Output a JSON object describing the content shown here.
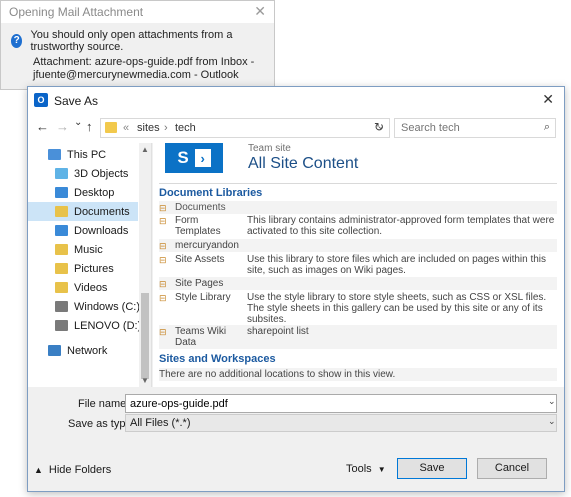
{
  "bg_dialog": {
    "title": "Opening Mail Attachment",
    "warning": "You should only open attachments from a trustworthy source.",
    "attachment_line1": "Attachment: azure-ops-guide.pdf from Inbox -",
    "attachment_line2": "jfuente@mercurynewmedia.com - Outlook",
    "close": "✕"
  },
  "dialog": {
    "title": "Save As",
    "close": "✕"
  },
  "nav": {
    "back": "←",
    "forward": "→",
    "recent": "⌄",
    "up": "↑",
    "path_sep_start": "«",
    "path": [
      "sites",
      "tech"
    ],
    "path_sep": "›",
    "refresh": "↻",
    "search_placeholder": "Search tech"
  },
  "sidebar": {
    "items": [
      {
        "label": "This PC",
        "icon": "computer-icon",
        "color": "#4a90d9"
      },
      {
        "label": "3D Objects",
        "icon": "folder-3d-icon",
        "color": "#5fb3e6"
      },
      {
        "label": "Desktop",
        "icon": "folder-desktop-icon",
        "color": "#3a8ad8"
      },
      {
        "label": "Documents",
        "icon": "folder-documents-icon",
        "color": "#e8c24a"
      },
      {
        "label": "Downloads",
        "icon": "folder-downloads-icon",
        "color": "#3a8ad8"
      },
      {
        "label": "Music",
        "icon": "folder-music-icon",
        "color": "#e8c24a"
      },
      {
        "label": "Pictures",
        "icon": "folder-pictures-icon",
        "color": "#e8c24a"
      },
      {
        "label": "Videos",
        "icon": "folder-videos-icon",
        "color": "#e8c24a"
      },
      {
        "label": "Windows (C:)",
        "icon": "drive-icon",
        "color": "#7a7a7a"
      },
      {
        "label": "LENOVO (D:)",
        "icon": "drive-icon",
        "color": "#7a7a7a"
      },
      {
        "label": "Network",
        "icon": "network-icon",
        "color": "#3a7fc4"
      }
    ],
    "selected": "Documents"
  },
  "sharepoint": {
    "site_label": "Team site",
    "site_title": "All Site Content",
    "doc_libraries_heading": "Document Libraries",
    "libraries": [
      {
        "name": "Documents",
        "desc": ""
      },
      {
        "name": "Form Templates",
        "desc": "This library contains administrator-approved form templates that were activated to this site collection."
      },
      {
        "name": "mercuryandon",
        "desc": ""
      },
      {
        "name": "Site Assets",
        "desc": "Use this library to store files which are included on pages within this site, such as images on Wiki pages."
      },
      {
        "name": "Site Pages",
        "desc": ""
      },
      {
        "name": "Style Library",
        "desc": "Use the style library to store style sheets, such as CSS or XSL files. The style sheets in this gallery can be used by this site or any of its subsites."
      },
      {
        "name": "Teams Wiki Data",
        "desc": "sharepoint list"
      }
    ],
    "sites_heading": "Sites and Workspaces",
    "sites_empty": "There are no additional locations to show in this view."
  },
  "form": {
    "file_name_label": "File name:",
    "file_name_value": "azure-ops-guide.pdf",
    "save_type_label": "Save as type:",
    "save_type_value": "All Files (*.*)"
  },
  "footer": {
    "hide_folders": "Hide Folders",
    "tools": "Tools",
    "save": "Save",
    "cancel": "Cancel"
  },
  "colors": {
    "accent": "#0078d7",
    "sharepoint_blue": "#0b72c6",
    "heading_blue": "#1c5aa0",
    "selected_bg": "#cce4f7"
  }
}
